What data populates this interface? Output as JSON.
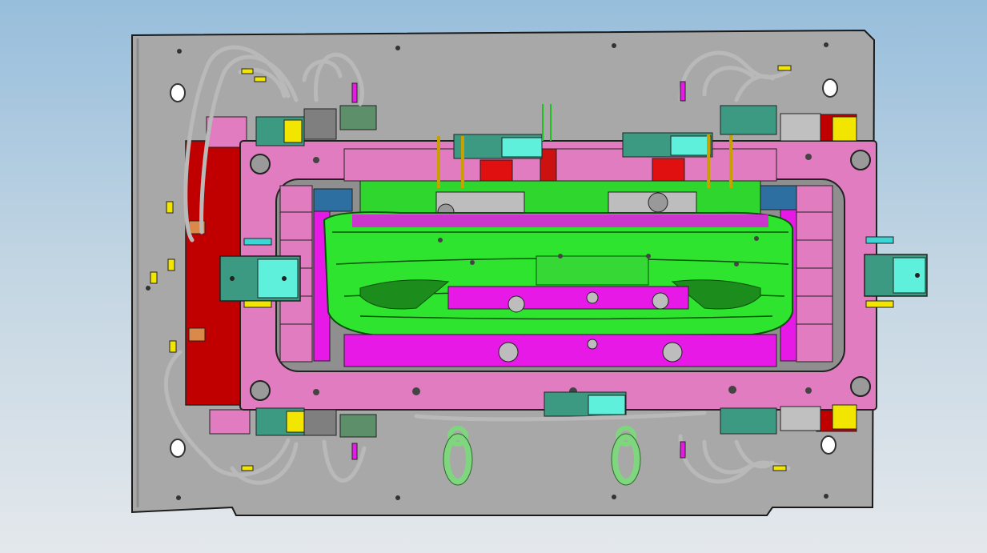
{
  "viewport": {
    "background": {
      "top": "#97bedc",
      "bottom": "#e4e8ec"
    }
  },
  "model": {
    "colors": {
      "base_plate": "#a9a9a9",
      "frame_pink": "#e07cbf",
      "cavity_green": "#27e427",
      "magenta": "#e619e6",
      "red_block": "#c00000",
      "teal_cylinder": "#3c9a82",
      "cyan_cap": "#5ff0dc",
      "yellow": "#f2e600",
      "hose": "#c8c8c8",
      "lifting_ring": "#8ee08e",
      "steel_grey": "#8c8c8c",
      "edge": "#1a1a1a"
    },
    "parts": [
      "base-plate",
      "pink-mold-frame",
      "bumper-cavity",
      "hydraulic-cylinders",
      "hose-bundles",
      "lifting-rings",
      "slider-blocks"
    ]
  }
}
